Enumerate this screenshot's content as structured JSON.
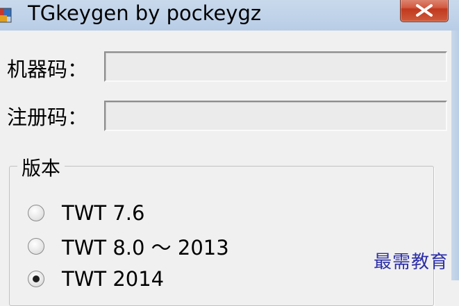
{
  "window": {
    "title": "TGkeygen by pockeygz"
  },
  "form": {
    "machine_code_label": "机器码：",
    "machine_code_value": "",
    "registration_code_label": "注册码：",
    "registration_code_value": ""
  },
  "version_group": {
    "title": "版本",
    "options": [
      {
        "label": "TWT 7.6",
        "checked": false
      },
      {
        "label": "TWT 8.0 ～ 2013",
        "checked": false
      },
      {
        "label": "TWT 2014",
        "checked": true
      }
    ]
  },
  "watermark": "最需教育",
  "colors": {
    "titlebar": "#c1d4ea",
    "close_button": "#c9452a",
    "window_bg": "#f0f0f0",
    "watermark": "#2d2fa8"
  },
  "icons": [
    "app-icon",
    "close-icon"
  ]
}
